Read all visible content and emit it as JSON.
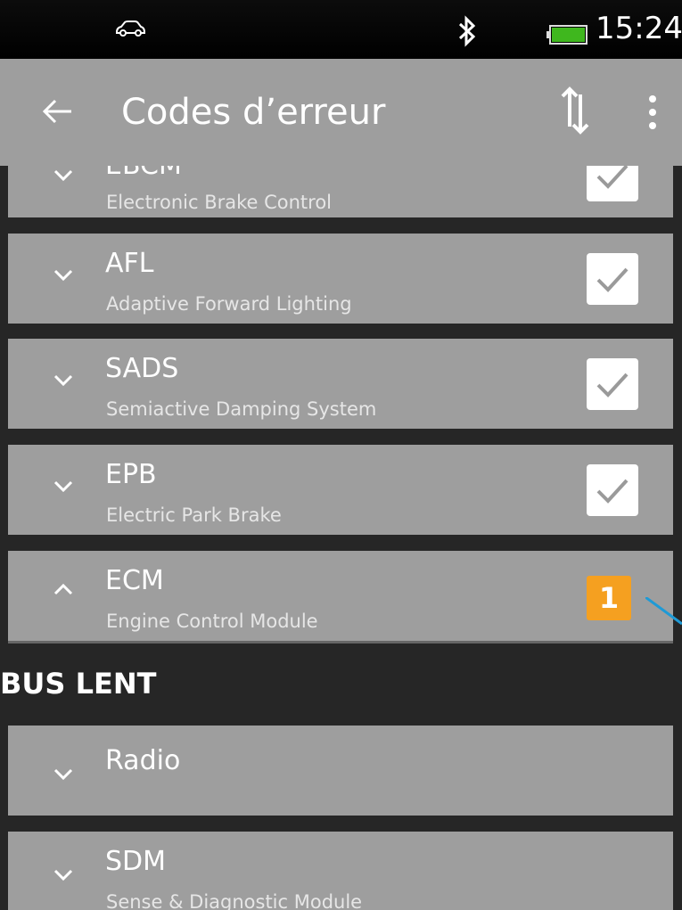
{
  "status_bar": {
    "time": "15:24",
    "icons": [
      "car-icon",
      "bluetooth-icon",
      "battery-icon"
    ],
    "battery_color": "#3fb71e"
  },
  "app_bar": {
    "title": "Codes d’erreur",
    "icons": [
      "back-arrow-icon",
      "sort-icon",
      "more-vert-icon"
    ]
  },
  "modules_fast_bus": [
    {
      "code": "EBCM",
      "name": "Electronic Brake Control",
      "expanded": false,
      "status": "ok"
    },
    {
      "code": "AFL",
      "name": "Adaptive Forward Lighting",
      "expanded": false,
      "status": "ok"
    },
    {
      "code": "SADS",
      "name": "Semiactive Damping System",
      "expanded": false,
      "status": "ok"
    },
    {
      "code": "EPB",
      "name": "Electric Park Brake",
      "expanded": false,
      "status": "ok"
    },
    {
      "code": "ECM",
      "name": "Engine Control Module",
      "expanded": true,
      "status": "error",
      "error_count": "1"
    }
  ],
  "section_slow_bus": {
    "title": "BUS LENT"
  },
  "modules_slow_bus": [
    {
      "code": "Radio",
      "name": "",
      "expanded": false
    },
    {
      "code": "SDM",
      "name": "Sense & Diagnostic Module",
      "expanded": false
    }
  ],
  "colors": {
    "card_bg": "#9e9e9e",
    "page_bg": "#262626",
    "badge": "#f5a020",
    "accent_line": "#1e9ad6"
  }
}
